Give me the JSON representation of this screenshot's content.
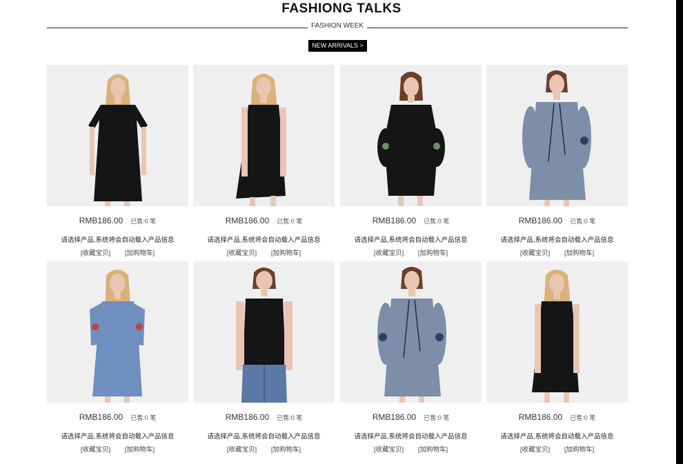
{
  "header": {
    "title": "FASHIONG TALKS",
    "subtitle": "FASHION WEEK",
    "cta_label": "NEW ARRIVALS >"
  },
  "products": [
    {
      "price": "RMB186.00",
      "sold": "已售:0 笔",
      "desc": "请选择产品,系统将会自动载入产品信息",
      "favorite": "[收藏宝贝]",
      "cart": "[加购物车]",
      "image": "model-black-tshirt-dress"
    },
    {
      "price": "RMB186.00",
      "sold": "已售:0 笔",
      "desc": "请选择产品,系统将会自动载入产品信息",
      "favorite": "[收藏宝贝]",
      "cart": "[加购物车]",
      "image": "model-black-wrap-dress"
    },
    {
      "price": "RMB186.00",
      "sold": "已售:0 笔",
      "desc": "请选择产品,系统将会自动载入产品信息",
      "favorite": "[收藏宝贝]",
      "cart": "[加购物车]",
      "image": "model-black-embroidered-sleeve-dress"
    },
    {
      "price": "RMB186.00",
      "sold": "已售:0 笔",
      "desc": "请选择产品,系统将会自动载入产品信息",
      "favorite": "[收藏宝贝]",
      "cart": "[加购物车]",
      "image": "model-blue-tunic-dress"
    },
    {
      "price": "RMB186.00",
      "sold": "已售:0 笔",
      "desc": "请选择产品,系统将会自动载入产品信息",
      "favorite": "[收藏宝贝]",
      "cart": "[加购物车]",
      "image": "model-denim-cold-shoulder-dress"
    },
    {
      "price": "RMB186.00",
      "sold": "已售:0 笔",
      "desc": "请选择产品,系统将会自动载入产品信息",
      "favorite": "[收藏宝贝]",
      "cart": "[加购物车]",
      "image": "model-black-ruffle-top-jeans"
    },
    {
      "price": "RMB186.00",
      "sold": "已售:0 笔",
      "desc": "请选择产品,系统将会自动载入产品信息",
      "favorite": "[收藏宝贝]",
      "cart": "[加购物车]",
      "image": "model-blue-tunic-dress-alt"
    },
    {
      "price": "RMB186.00",
      "sold": "已售:0 笔",
      "desc": "请选择产品,系统将会自动载入产品信息",
      "favorite": "[收藏宝贝]",
      "cart": "[加购物车]",
      "image": "model-black-wrap-dress-alt"
    }
  ],
  "colors": {
    "accent": "#000000",
    "photo_bg": "#efefef",
    "black_garment": "#151515",
    "blue_garment": "#7d8fa8",
    "denim": "#6f8fbf",
    "skin": "#e9c6b3",
    "blonde_hair": "#d9b27a",
    "brown_hair": "#6b3f28"
  }
}
